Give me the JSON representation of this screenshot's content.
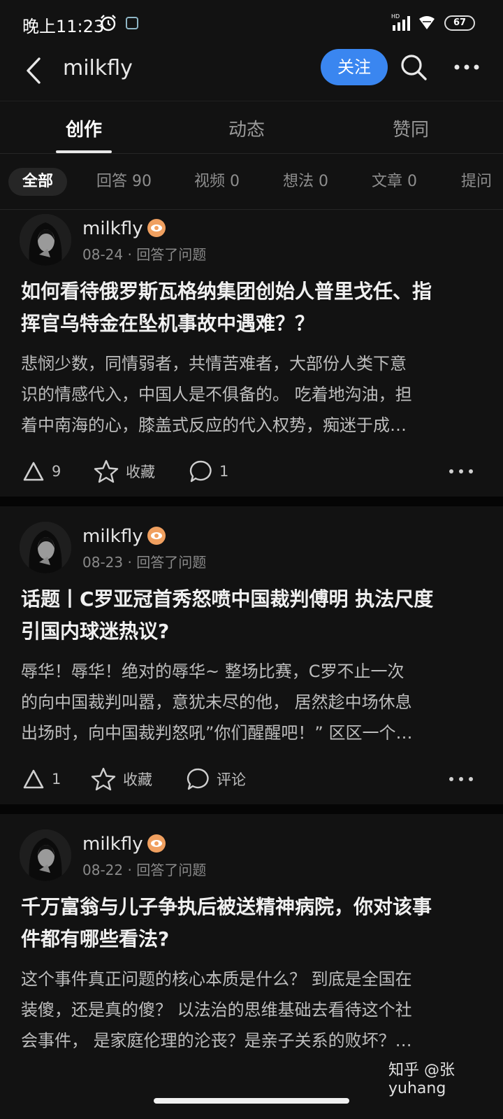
{
  "status_bar": {
    "time": "晚上11:23",
    "network_label": "HD",
    "battery": "67"
  },
  "header": {
    "back_icon": "chevron-left-icon",
    "title": "milkfly",
    "follow_label": "关注",
    "search_icon": "search-icon",
    "more_icon": "more-horizontal-icon"
  },
  "tabs": [
    {
      "label": "创作",
      "active": true
    },
    {
      "label": "动态",
      "active": false
    },
    {
      "label": "赞同",
      "active": false
    }
  ],
  "filters": [
    {
      "label": "全部",
      "active": true
    },
    {
      "label": "回答 90",
      "active": false
    },
    {
      "label": "视频 0",
      "active": false
    },
    {
      "label": "想法 0",
      "active": false
    },
    {
      "label": "文章 0",
      "active": false
    },
    {
      "label": "提问",
      "active": false
    }
  ],
  "cards": [
    {
      "author": "milkfly",
      "date": "08-24",
      "action": "回答了问题",
      "title_line1": "如何看待俄罗斯瓦格纳集团创始人普里戈任、指",
      "title_line2": "挥官乌特金在坠机事故中遇难？？",
      "excerpt_line1": "悲悯少数，同情弱者，共情苦难者，大部份人类下意",
      "excerpt_line2": "识的情感代入，中国人是不俱备的。 吃着地沟油，担",
      "excerpt_line3": "着中南海的心，膝盖式反应的代入权势，痴迷于成…",
      "upvotes": "9",
      "favorite_label": "收藏",
      "comments": "1"
    },
    {
      "author": "milkfly",
      "date": "08-23",
      "action": "回答了问题",
      "title_line1": "话题丨C罗亚冠首秀怒喷中国裁判傅明 执法尺度",
      "title_line2": "引国内球迷热议?",
      "excerpt_line1": "辱华！辱华！绝对的辱华~ 整场比赛，C罗不止一次",
      "excerpt_line2": "的向中国裁判叫嚣，意犹未尽的他， 居然趁中场休息",
      "excerpt_line3": "出场时，向中国裁判怒吼”你们醒醒吧！” 区区一个…",
      "upvotes": "1",
      "favorite_label": "收藏",
      "comments": "评论"
    },
    {
      "author": "milkfly",
      "date": "08-22",
      "action": "回答了问题",
      "title_line1": "千万富翁与儿子争执后被送精神病院，你对该事",
      "title_line2": "件都有哪些看法?",
      "excerpt_line1": "这个事件真正问题的核心本质是什么？ 到底是全国在",
      "excerpt_line2": "装傻，还是真的傻？ 以法治的思维基础去看待这个社",
      "excerpt_line3": "会事件， 是家庭伦理的沦丧？是亲子关系的败坏？…"
    }
  ],
  "watermark": "知乎 @张yuhang",
  "colors": {
    "background": "#121212",
    "accent": "#3a86f0",
    "badge": "#f0a060"
  }
}
